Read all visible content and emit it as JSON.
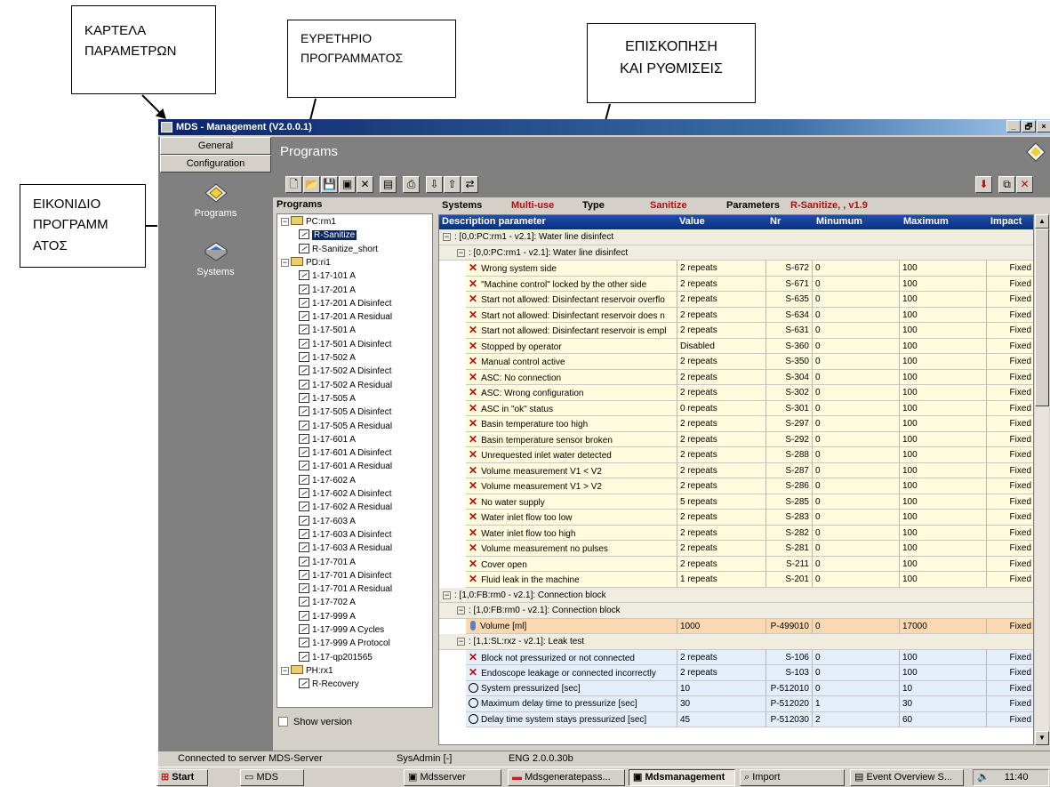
{
  "callouts": {
    "params_tab": "ΚΑΡΤΕΛΑ\nΠΑΡΑΜΕΤΡΩΝ",
    "program_index": "ΕΥΡΕΤΗΡΙΟ\nΠΡΟΓΡΑΜΜΑΤΟΣ",
    "overview": "ΕΠΙΣΚΟΠΗΣΗ\nΚΑΙ ΡΥΘΜΙΣΕΙΣ",
    "program_icon": "ΕΙΚΟΝΙΔΙΟ\nΠΡΟΓΡΑΜΜ\nΑΤΟΣ"
  },
  "window": {
    "title": "MDS - Management  (V2.0.0.1)",
    "min": "_",
    "max": "🗗",
    "close": "×"
  },
  "nav": {
    "general": "General",
    "configuration": "Configuration",
    "programs": "Programs",
    "systems": "Systems"
  },
  "header": {
    "title": "Programs"
  },
  "programs_panel": {
    "title": "Programs",
    "show_version": "Show version",
    "tree": [
      {
        "label": "PC:rm1",
        "level": 0,
        "kind": "folder"
      },
      {
        "label": "R-Sanitize",
        "level": 1,
        "kind": "doc",
        "selected": true
      },
      {
        "label": "R-Sanitize_short",
        "level": 1,
        "kind": "doc"
      },
      {
        "label": "PD:ri1",
        "level": 0,
        "kind": "folder"
      },
      {
        "label": "1-17-101 A",
        "level": 1,
        "kind": "doc"
      },
      {
        "label": "1-17-201 A",
        "level": 1,
        "kind": "doc"
      },
      {
        "label": "1-17-201 A Disinfect",
        "level": 1,
        "kind": "doc"
      },
      {
        "label": "1-17-201 A Residual",
        "level": 1,
        "kind": "doc"
      },
      {
        "label": "1-17-501 A",
        "level": 1,
        "kind": "doc"
      },
      {
        "label": "1-17-501 A Disinfect",
        "level": 1,
        "kind": "doc"
      },
      {
        "label": "1-17-502 A",
        "level": 1,
        "kind": "doc"
      },
      {
        "label": "1-17-502 A Disinfect",
        "level": 1,
        "kind": "doc"
      },
      {
        "label": "1-17-502 A Residual",
        "level": 1,
        "kind": "doc"
      },
      {
        "label": "1-17-505 A",
        "level": 1,
        "kind": "doc"
      },
      {
        "label": "1-17-505 A Disinfect",
        "level": 1,
        "kind": "doc"
      },
      {
        "label": "1-17-505 A Residual",
        "level": 1,
        "kind": "doc"
      },
      {
        "label": "1-17-601 A",
        "level": 1,
        "kind": "doc"
      },
      {
        "label": "1-17-601 A Disinfect",
        "level": 1,
        "kind": "doc"
      },
      {
        "label": "1-17-601 A Residual",
        "level": 1,
        "kind": "doc"
      },
      {
        "label": "1-17-602 A",
        "level": 1,
        "kind": "doc"
      },
      {
        "label": "1-17-602 A Disinfect",
        "level": 1,
        "kind": "doc"
      },
      {
        "label": "1-17-602 A Residual",
        "level": 1,
        "kind": "doc"
      },
      {
        "label": "1-17-603 A",
        "level": 1,
        "kind": "doc"
      },
      {
        "label": "1-17-603 A Disinfect",
        "level": 1,
        "kind": "doc"
      },
      {
        "label": "1-17-603 A Residual",
        "level": 1,
        "kind": "doc"
      },
      {
        "label": "1-17-701 A",
        "level": 1,
        "kind": "doc"
      },
      {
        "label": "1-17-701 A Disinfect",
        "level": 1,
        "kind": "doc"
      },
      {
        "label": "1-17-701 A Residual",
        "level": 1,
        "kind": "doc"
      },
      {
        "label": "1-17-702 A",
        "level": 1,
        "kind": "doc"
      },
      {
        "label": "1-17-999 A",
        "level": 1,
        "kind": "doc"
      },
      {
        "label": "1-17-999 A Cycles",
        "level": 1,
        "kind": "doc"
      },
      {
        "label": "1-17-999 A Protocol",
        "level": 1,
        "kind": "doc"
      },
      {
        "label": "1-17-qp201565",
        "level": 1,
        "kind": "doc"
      },
      {
        "label": "PH:rx1",
        "level": 0,
        "kind": "folder"
      },
      {
        "label": "R-Recovery",
        "level": 1,
        "kind": "doc"
      }
    ]
  },
  "systems_bar": {
    "systems_label": "Systems",
    "systems_value": "Multi-use",
    "type_label": "Type",
    "type_value": "Sanitize",
    "params_label": "Parameters",
    "params_value": "R-Sanitize, , v1.9"
  },
  "grid": {
    "columns": [
      "Description parameter",
      "Value",
      "Nr",
      "Minumum",
      "Maximum",
      "Impact"
    ],
    "rows": [
      {
        "kind": "group",
        "level": 0,
        "text": ": [0,0:PC:rm1 - v2.1]: Water line disinfect"
      },
      {
        "kind": "group",
        "level": 1,
        "text": ": [0,0:PC:rm1 - v2.1]: Water line disinfect"
      },
      {
        "kind": "item",
        "icon": "x",
        "bg": "ylw",
        "desc": "Wrong system side",
        "value": "2 repeats",
        "nr": "S-672",
        "min": "0",
        "max": "100",
        "impact": "Fixed"
      },
      {
        "kind": "item",
        "icon": "x",
        "bg": "ylw",
        "desc": "\"Machine control\" locked by the other side",
        "value": "2 repeats",
        "nr": "S-671",
        "min": "0",
        "max": "100",
        "impact": "Fixed"
      },
      {
        "kind": "item",
        "icon": "x",
        "bg": "ylw",
        "desc": "Start not allowed: Disinfectant reservoir overflo",
        "value": "2 repeats",
        "nr": "S-635",
        "min": "0",
        "max": "100",
        "impact": "Fixed"
      },
      {
        "kind": "item",
        "icon": "x",
        "bg": "ylw",
        "desc": "Start not allowed: Disinfectant reservoir does n",
        "value": "2 repeats",
        "nr": "S-634",
        "min": "0",
        "max": "100",
        "impact": "Fixed"
      },
      {
        "kind": "item",
        "icon": "x",
        "bg": "ylw",
        "desc": "Start not allowed: Disinfectant reservoir is empl",
        "value": "2 repeats",
        "nr": "S-631",
        "min": "0",
        "max": "100",
        "impact": "Fixed"
      },
      {
        "kind": "item",
        "icon": "x",
        "bg": "ylw",
        "desc": "Stopped by operator",
        "value": "Disabled",
        "nr": "S-360",
        "min": "0",
        "max": "100",
        "impact": "Fixed"
      },
      {
        "kind": "item",
        "icon": "x",
        "bg": "ylw",
        "desc": "Manual control active",
        "value": "2 repeats",
        "nr": "S-350",
        "min": "0",
        "max": "100",
        "impact": "Fixed"
      },
      {
        "kind": "item",
        "icon": "x",
        "bg": "ylw",
        "desc": "ASC: No connection",
        "value": "2 repeats",
        "nr": "S-304",
        "min": "0",
        "max": "100",
        "impact": "Fixed"
      },
      {
        "kind": "item",
        "icon": "x",
        "bg": "ylw",
        "desc": "ASC: Wrong configuration",
        "value": "2 repeats",
        "nr": "S-302",
        "min": "0",
        "max": "100",
        "impact": "Fixed"
      },
      {
        "kind": "item",
        "icon": "x",
        "bg": "ylw",
        "desc": "ASC in \"ok\" status",
        "value": "0 repeats",
        "nr": "S-301",
        "min": "0",
        "max": "100",
        "impact": "Fixed"
      },
      {
        "kind": "item",
        "icon": "x",
        "bg": "ylw",
        "desc": "Basin temperature too high",
        "value": "2 repeats",
        "nr": "S-297",
        "min": "0",
        "max": "100",
        "impact": "Fixed"
      },
      {
        "kind": "item",
        "icon": "x",
        "bg": "ylw",
        "desc": "Basin temperature sensor broken",
        "value": "2 repeats",
        "nr": "S-292",
        "min": "0",
        "max": "100",
        "impact": "Fixed"
      },
      {
        "kind": "item",
        "icon": "x",
        "bg": "ylw",
        "desc": "Unrequested inlet water detected",
        "value": "2 repeats",
        "nr": "S-288",
        "min": "0",
        "max": "100",
        "impact": "Fixed"
      },
      {
        "kind": "item",
        "icon": "x",
        "bg": "ylw",
        "desc": "Volume measurement V1 < V2",
        "value": "2 repeats",
        "nr": "S-287",
        "min": "0",
        "max": "100",
        "impact": "Fixed"
      },
      {
        "kind": "item",
        "icon": "x",
        "bg": "ylw",
        "desc": "Volume measurement V1 > V2",
        "value": "2 repeats",
        "nr": "S-286",
        "min": "0",
        "max": "100",
        "impact": "Fixed"
      },
      {
        "kind": "item",
        "icon": "x",
        "bg": "ylw",
        "desc": "No water supply",
        "value": "5 repeats",
        "nr": "S-285",
        "min": "0",
        "max": "100",
        "impact": "Fixed"
      },
      {
        "kind": "item",
        "icon": "x",
        "bg": "ylw",
        "desc": "Water inlet flow too low",
        "value": "2 repeats",
        "nr": "S-283",
        "min": "0",
        "max": "100",
        "impact": "Fixed"
      },
      {
        "kind": "item",
        "icon": "x",
        "bg": "ylw",
        "desc": "Water inlet flow too high",
        "value": "2 repeats",
        "nr": "S-282",
        "min": "0",
        "max": "100",
        "impact": "Fixed"
      },
      {
        "kind": "item",
        "icon": "x",
        "bg": "ylw",
        "desc": "Volume measurement no pulses",
        "value": "2 repeats",
        "nr": "S-281",
        "min": "0",
        "max": "100",
        "impact": "Fixed"
      },
      {
        "kind": "item",
        "icon": "x",
        "bg": "ylw",
        "desc": "Cover open",
        "value": "2 repeats",
        "nr": "S-211",
        "min": "0",
        "max": "100",
        "impact": "Fixed"
      },
      {
        "kind": "item",
        "icon": "x",
        "bg": "ylw",
        "desc": "Fluid leak in the machine",
        "value": "1 repeats",
        "nr": "S-201",
        "min": "0",
        "max": "100",
        "impact": "Fixed"
      },
      {
        "kind": "group",
        "level": 0,
        "text": ": [1,0:FB:rm0 - v2.1]: Connection block"
      },
      {
        "kind": "group",
        "level": 1,
        "text": ": [1,0:FB:rm0 - v2.1]: Connection block"
      },
      {
        "kind": "item",
        "icon": "thermo",
        "bg": "orn",
        "desc": "Volume [ml]",
        "value": "1000",
        "nr": "P-499010",
        "min": "0",
        "max": "17000",
        "impact": "Fixed"
      },
      {
        "kind": "group",
        "level": 1,
        "text": ": [1,1:SL:rxz - v2.1]: Leak  test"
      },
      {
        "kind": "item",
        "icon": "x",
        "bg": "blu",
        "desc": "Block not pressurized or not connected",
        "value": "2 repeats",
        "nr": "S-106",
        "min": "0",
        "max": "100",
        "impact": "Fixed"
      },
      {
        "kind": "item",
        "icon": "x",
        "bg": "blu",
        "desc": "Endoscope leakage or connected incorrectly",
        "value": "2 repeats",
        "nr": "S-103",
        "min": "0",
        "max": "100",
        "impact": "Fixed"
      },
      {
        "kind": "item",
        "icon": "clock",
        "bg": "blu",
        "desc": "System pressurized [sec]",
        "value": "10",
        "nr": "P-512010",
        "min": "0",
        "max": "10",
        "impact": "Fixed"
      },
      {
        "kind": "item",
        "icon": "clock",
        "bg": "blu",
        "desc": "Maximum delay time to pressurize [sec]",
        "value": "30",
        "nr": "P-512020",
        "min": "1",
        "max": "30",
        "impact": "Fixed"
      },
      {
        "kind": "item",
        "icon": "clock",
        "bg": "blu",
        "desc": "Delay time system stays pressurized [sec]",
        "value": "45",
        "nr": "P-512030",
        "min": "2",
        "max": "60",
        "impact": "Fixed"
      }
    ]
  },
  "status": {
    "connected": "Connected to server MDS-Server",
    "user": "SysAdmin [-]",
    "version": "ENG 2.0.0.30b"
  },
  "taskbar": {
    "start": "Start",
    "items": [
      "MDS",
      "Mdsserver",
      "Mdsgeneratepass...",
      "Mdsmanagement",
      "Import",
      "Event Overview S..."
    ],
    "clock": "11:40"
  },
  "colors": {
    "titlebar": "#0a246a",
    "grid_header": "#0a2e80",
    "row_yellow": "#fffbdc",
    "row_blue": "#e4eefa",
    "row_orange": "#fcd8b0",
    "accent_red": "#b01010"
  }
}
